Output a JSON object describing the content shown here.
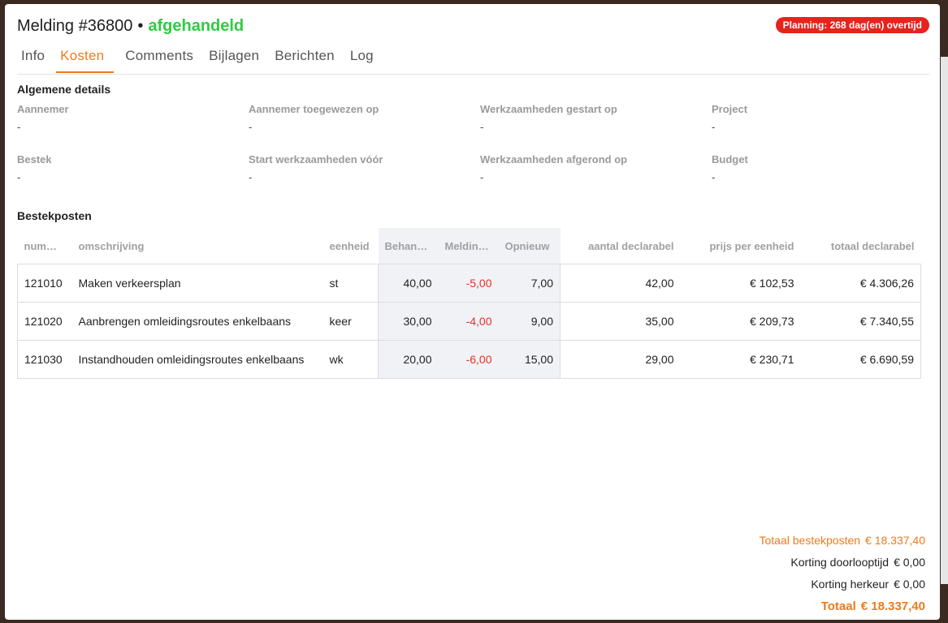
{
  "header": {
    "title": "Melding #36800",
    "separator": "•",
    "status": "afgehandeld",
    "badge": "Planning: 268 dag(en) overtijd"
  },
  "tabs": [
    {
      "label": "Info"
    },
    {
      "label": "Kosten"
    },
    {
      "label": "Comments"
    },
    {
      "label": "Bijlagen"
    },
    {
      "label": "Berichten"
    },
    {
      "label": "Log"
    }
  ],
  "details": {
    "section_title": "Algemene details",
    "fields": [
      {
        "label": "Aannemer",
        "value": "-"
      },
      {
        "label": "Aannemer toegewezen op",
        "value": "-"
      },
      {
        "label": "Werkzaamheden gestart op",
        "value": "-"
      },
      {
        "label": "Project",
        "value": "-"
      },
      {
        "label": "Bestek",
        "value": "-"
      },
      {
        "label": "Start werkzaamheden vóór",
        "value": "-"
      },
      {
        "label": "Werkzaamheden afgerond op",
        "value": "-"
      },
      {
        "label": "Budget",
        "value": "-"
      }
    ]
  },
  "posts": {
    "section_title": "Bestekposten",
    "columns": [
      "nummer",
      "omschrijving",
      "eenheid",
      "Behandeld",
      "Melding ...",
      "Opnieuw",
      "aantal declarabel",
      "prijs per eenheid",
      "totaal declarabel"
    ],
    "rows": [
      [
        "121010",
        "Maken verkeersplan",
        "st",
        "40,00",
        "-5,00",
        "7,00",
        "42,00",
        "€ 102,53",
        "€ 4.306,26"
      ],
      [
        "121020",
        "Aanbrengen omleidingsroutes enkelbaans",
        "keer",
        "30,00",
        "-4,00",
        "9,00",
        "35,00",
        "€ 209,73",
        "€ 7.340,55"
      ],
      [
        "121030",
        "Instandhouden omleidingsroutes enkelbaans",
        "wk",
        "20,00",
        "-6,00",
        "15,00",
        "29,00",
        "€ 230,71",
        "€ 6.690,59"
      ]
    ]
  },
  "totals": {
    "bestekposten_label": "Totaal bestekposten",
    "bestekposten_value": "€ 18.337,40",
    "doorlooptijd_label": "Korting doorlooptijd",
    "doorlooptijd_value": "€ 0,00",
    "herkeur_label": "Korting herkeur",
    "herkeur_value": "€ 0,00",
    "totaal_label": "Totaal",
    "totaal_value": "€ 18.337,40"
  },
  "colors": {
    "accent": "#ee7a1c",
    "status_green": "#2ecc40",
    "badge_red": "#e6231d",
    "negative": "#e2322b"
  }
}
